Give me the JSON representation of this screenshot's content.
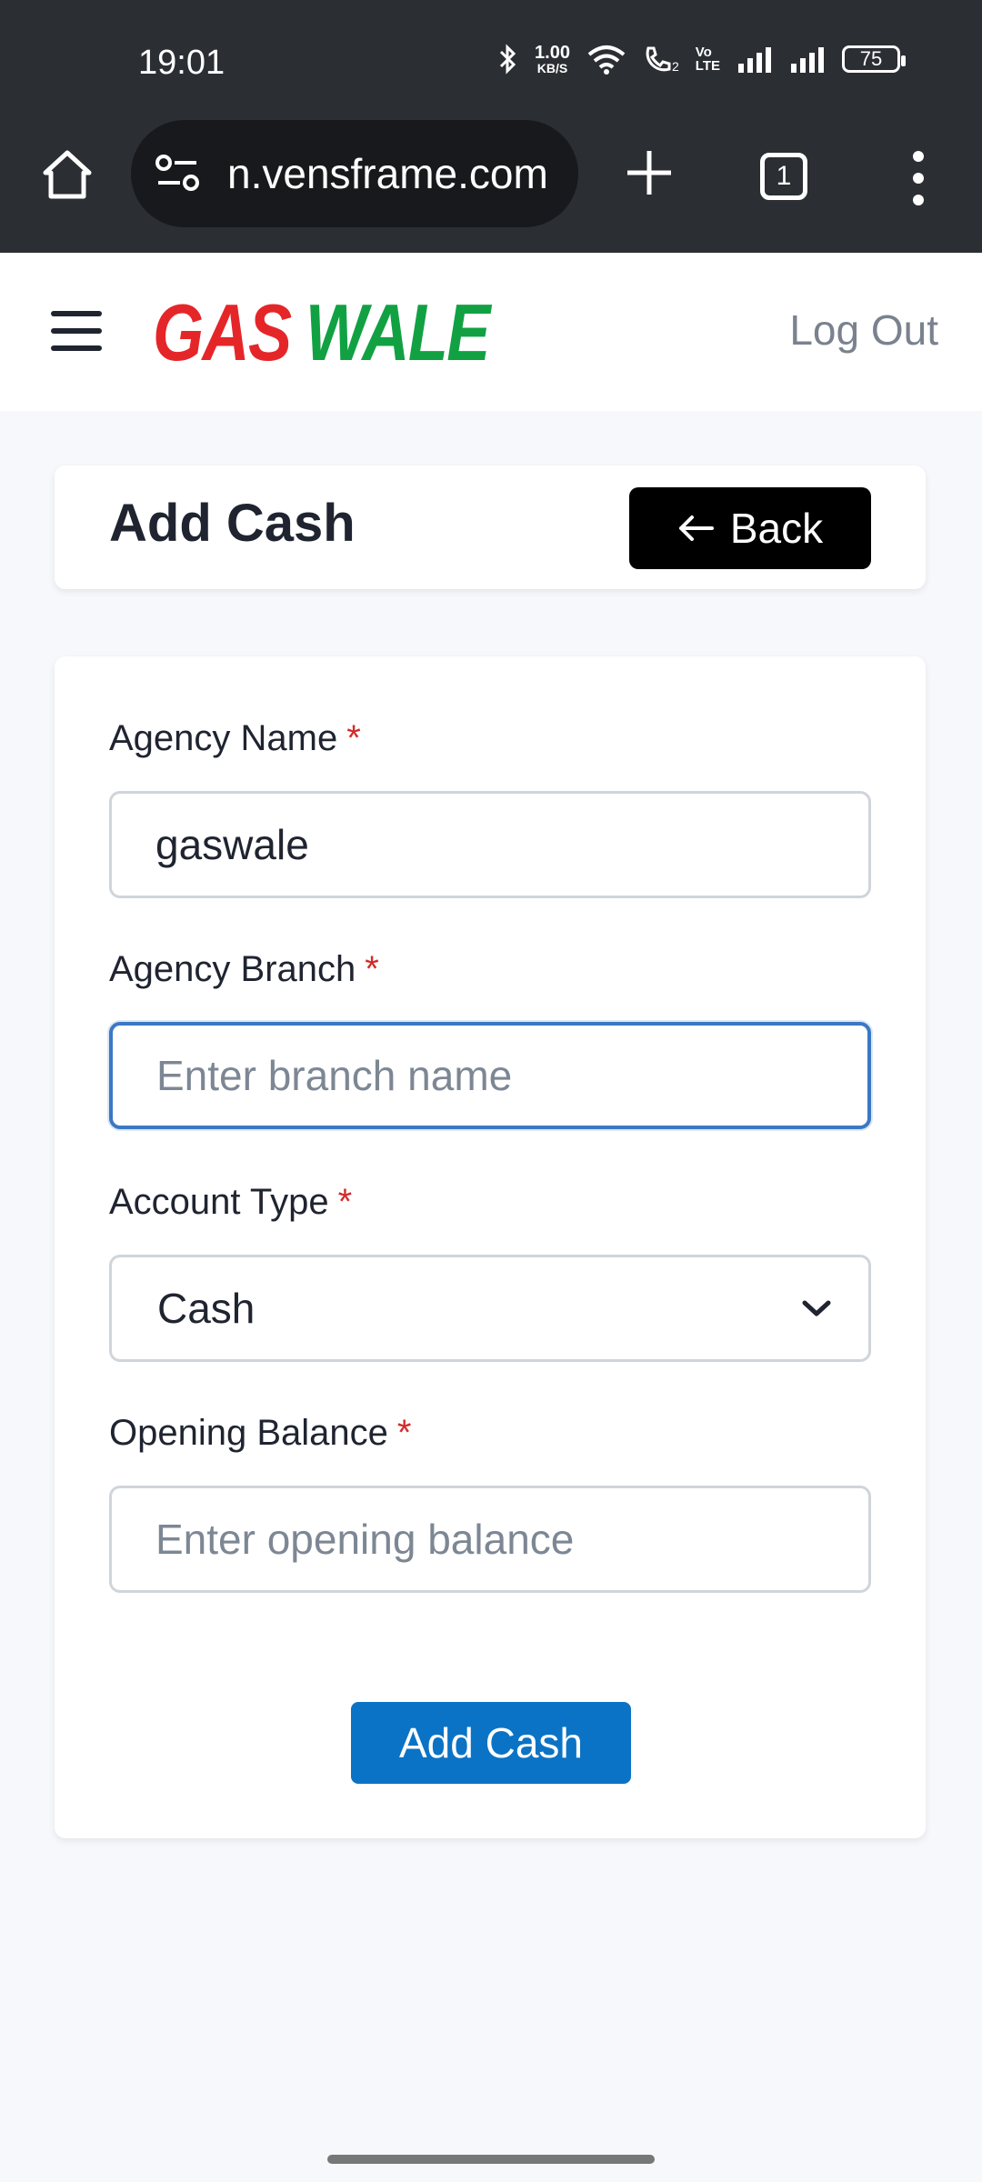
{
  "status_bar": {
    "time": "19:01",
    "net_speed_value": "1.00",
    "net_speed_unit": "KB/S",
    "volte_top": "Vo",
    "volte_bottom": "LTE",
    "call_sim": "2",
    "battery": "75"
  },
  "browser": {
    "url": "n.vensframe.com",
    "tab_count": "1"
  },
  "header": {
    "logo_part1": "GAS",
    "logo_part2": "WALE",
    "logout_label": "Log Out",
    "logo_colors": {
      "gas": "#e52629",
      "wale": "#11a143"
    }
  },
  "title_card": {
    "title": "Add Cash",
    "back_label": "Back"
  },
  "form": {
    "agency_name": {
      "label": "Agency Name",
      "required": "*",
      "value": "gaswale"
    },
    "agency_branch": {
      "label": "Agency Branch",
      "required": "*",
      "placeholder": "Enter branch name",
      "value": ""
    },
    "account_type": {
      "label": "Account Type",
      "required": "*",
      "selected": "Cash"
    },
    "opening_balance": {
      "label": "Opening Balance",
      "required": "*",
      "placeholder": "Enter opening balance",
      "value": ""
    },
    "submit_label": "Add Cash"
  },
  "colors": {
    "primary_button": "#0b73c5",
    "focus_border": "#3b78c4",
    "required_mark": "#d22b2b"
  }
}
